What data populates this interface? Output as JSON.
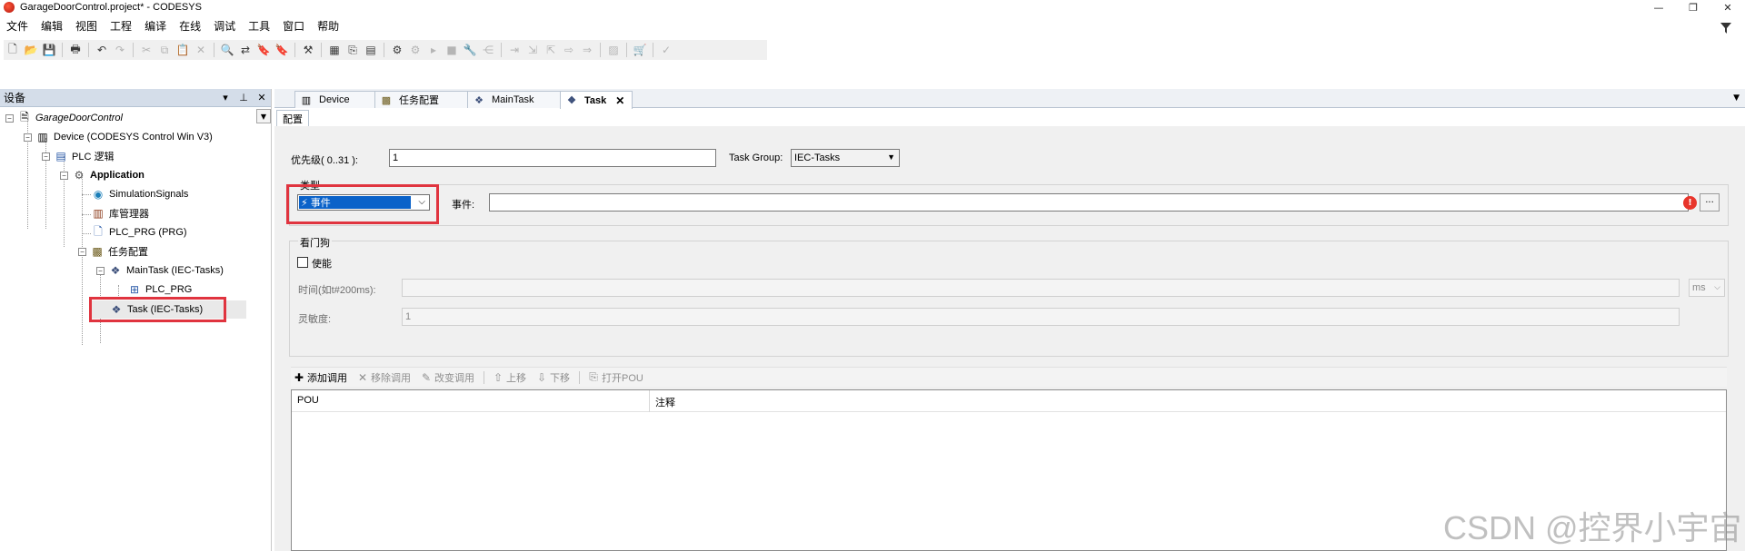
{
  "window": {
    "title": "GarageDoorControl.project* - CODESYS",
    "controls": [
      "—",
      "❐",
      "✕"
    ]
  },
  "menu": [
    "文件",
    "编辑",
    "视图",
    "工程",
    "编译",
    "在线",
    "调试",
    "工具",
    "窗口",
    "帮助"
  ],
  "toolbar_icons": [
    {
      "icon": "new-file-icon",
      "glyph": "🗋",
      "enabled": true
    },
    {
      "icon": "open-folder-icon",
      "glyph": "📂",
      "enabled": true
    },
    {
      "icon": "save-icon",
      "glyph": "💾",
      "enabled": true
    },
    {
      "icon": "print-icon",
      "glyph": "🖶",
      "enabled": true
    },
    {
      "icon": "undo-icon",
      "glyph": "↶",
      "enabled": true
    },
    {
      "icon": "redo-icon",
      "glyph": "↷",
      "enabled": false
    },
    {
      "icon": "cut-icon",
      "glyph": "✂",
      "enabled": false
    },
    {
      "icon": "copy-icon",
      "glyph": "⧉",
      "enabled": false
    },
    {
      "icon": "paste-icon",
      "glyph": "📋",
      "enabled": false
    },
    {
      "icon": "delete-icon",
      "glyph": "✕",
      "enabled": false
    },
    {
      "icon": "find-icon",
      "glyph": "🔍",
      "enabled": true
    },
    {
      "icon": "replace-icon",
      "glyph": "⇄",
      "enabled": true
    },
    {
      "icon": "bookmark-icon",
      "glyph": "🔖",
      "enabled": true
    },
    {
      "icon": "bookmark-next-icon",
      "glyph": "🔖",
      "enabled": true
    },
    {
      "icon": "build-icon",
      "glyph": "⚒",
      "enabled": true
    },
    {
      "icon": "device-config-icon",
      "glyph": "▦",
      "enabled": true
    },
    {
      "icon": "export-icon",
      "glyph": "⎘",
      "enabled": true
    },
    {
      "icon": "grid-icon",
      "glyph": "▤",
      "enabled": true
    },
    {
      "icon": "login-icon",
      "glyph": "⚙",
      "enabled": true
    },
    {
      "icon": "logout-icon",
      "glyph": "⚙",
      "enabled": false
    },
    {
      "icon": "run-icon",
      "glyph": "▸",
      "enabled": false
    },
    {
      "icon": "stop-icon",
      "glyph": "■",
      "enabled": false
    },
    {
      "icon": "reset-icon",
      "glyph": "🔧",
      "enabled": false
    },
    {
      "icon": "breakpoint-icon",
      "glyph": "⋲",
      "enabled": false
    },
    {
      "icon": "step-over-icon",
      "glyph": "⇥",
      "enabled": false
    },
    {
      "icon": "step-into-icon",
      "glyph": "⇲",
      "enabled": false
    },
    {
      "icon": "step-out-icon",
      "glyph": "⇱",
      "enabled": false
    },
    {
      "icon": "step-next-icon",
      "glyph": "⇨",
      "enabled": false
    },
    {
      "icon": "show-statement-icon",
      "glyph": "⇒",
      "enabled": false
    },
    {
      "icon": "write-values-icon",
      "glyph": "▨",
      "enabled": false
    },
    {
      "icon": "cart-icon",
      "glyph": "🛒",
      "enabled": true
    },
    {
      "icon": "check-icon",
      "glyph": "✓",
      "enabled": false
    }
  ],
  "left_panel": {
    "title": "设备",
    "tree": [
      {
        "label": "GarageDoorControl",
        "italic": true,
        "bold": false,
        "icon": "project-icon"
      },
      {
        "label": "Device (CODESYS Control Win V3)",
        "italic": false,
        "bold": false,
        "icon": "device-icon"
      },
      {
        "label": "PLC 逻辑",
        "italic": false,
        "bold": false,
        "icon": "plc-logic-icon"
      },
      {
        "label": "Application",
        "italic": false,
        "bold": true,
        "icon": "application-icon"
      },
      {
        "label": "SimulationSignals",
        "italic": false,
        "bold": false,
        "icon": "globe-icon"
      },
      {
        "label": "库管理器",
        "italic": false,
        "bold": false,
        "icon": "library-icon"
      },
      {
        "label": "PLC_PRG (PRG)",
        "italic": false,
        "bold": false,
        "icon": "program-icon"
      },
      {
        "label": "任务配置",
        "italic": false,
        "bold": false,
        "icon": "task-config-icon"
      },
      {
        "label": "MainTask (IEC-Tasks)",
        "italic": false,
        "bold": false,
        "icon": "task-icon"
      },
      {
        "label": "PLC_PRG",
        "italic": false,
        "bold": false,
        "icon": "program-call-icon"
      },
      {
        "label": "Task (IEC-Tasks)",
        "italic": false,
        "bold": false,
        "icon": "task-icon"
      }
    ]
  },
  "editor_tabs": [
    {
      "label": "Device",
      "active": false,
      "icon": "device-icon"
    },
    {
      "label": "任务配置",
      "active": false,
      "icon": "task-config-icon"
    },
    {
      "label": "MainTask",
      "active": false,
      "icon": "task-icon"
    },
    {
      "label": "Task",
      "active": true,
      "icon": "task-icon"
    }
  ],
  "subtab": "配置",
  "config": {
    "priority_label": "优先级( 0..31 ):",
    "priority_value": "1",
    "task_group_label": "Task Group:",
    "task_group_value": "IEC-Tasks",
    "type_group_label": "类型",
    "type_value": "事件",
    "event_label": "事件:",
    "event_value": "",
    "watchdog_group_label": "看门狗",
    "enable_label": "使能",
    "enable_checked": false,
    "time_label": "时间(如t#200ms):",
    "time_value": "",
    "time_unit": "ms",
    "sensitivity_label": "灵敏度:",
    "sensitivity_value": "1"
  },
  "calls_toolbar": [
    {
      "label": "添加调用",
      "icon": "add-icon",
      "glyph": "✚",
      "enabled": true
    },
    {
      "label": "移除调用",
      "icon": "remove-icon",
      "glyph": "✕",
      "enabled": false
    },
    {
      "label": "改变调用",
      "icon": "edit-icon",
      "glyph": "✎",
      "enabled": false
    },
    {
      "label": "上移",
      "icon": "move-up-icon",
      "glyph": "⇧",
      "enabled": false
    },
    {
      "label": "下移",
      "icon": "move-down-icon",
      "glyph": "⇩",
      "enabled": false
    },
    {
      "label": "打开POU",
      "icon": "open-pou-icon",
      "glyph": "⎘",
      "enabled": false
    }
  ],
  "calls_table": {
    "columns": [
      "POU",
      "注释"
    ],
    "rows": []
  },
  "watermark": "CSDN @控界小宇宙",
  "colors": {
    "highlight_red": "#e0343f",
    "selection_blue": "#0a62c9",
    "panel_header": "#d4dde9",
    "error_red": "#e8352b"
  }
}
